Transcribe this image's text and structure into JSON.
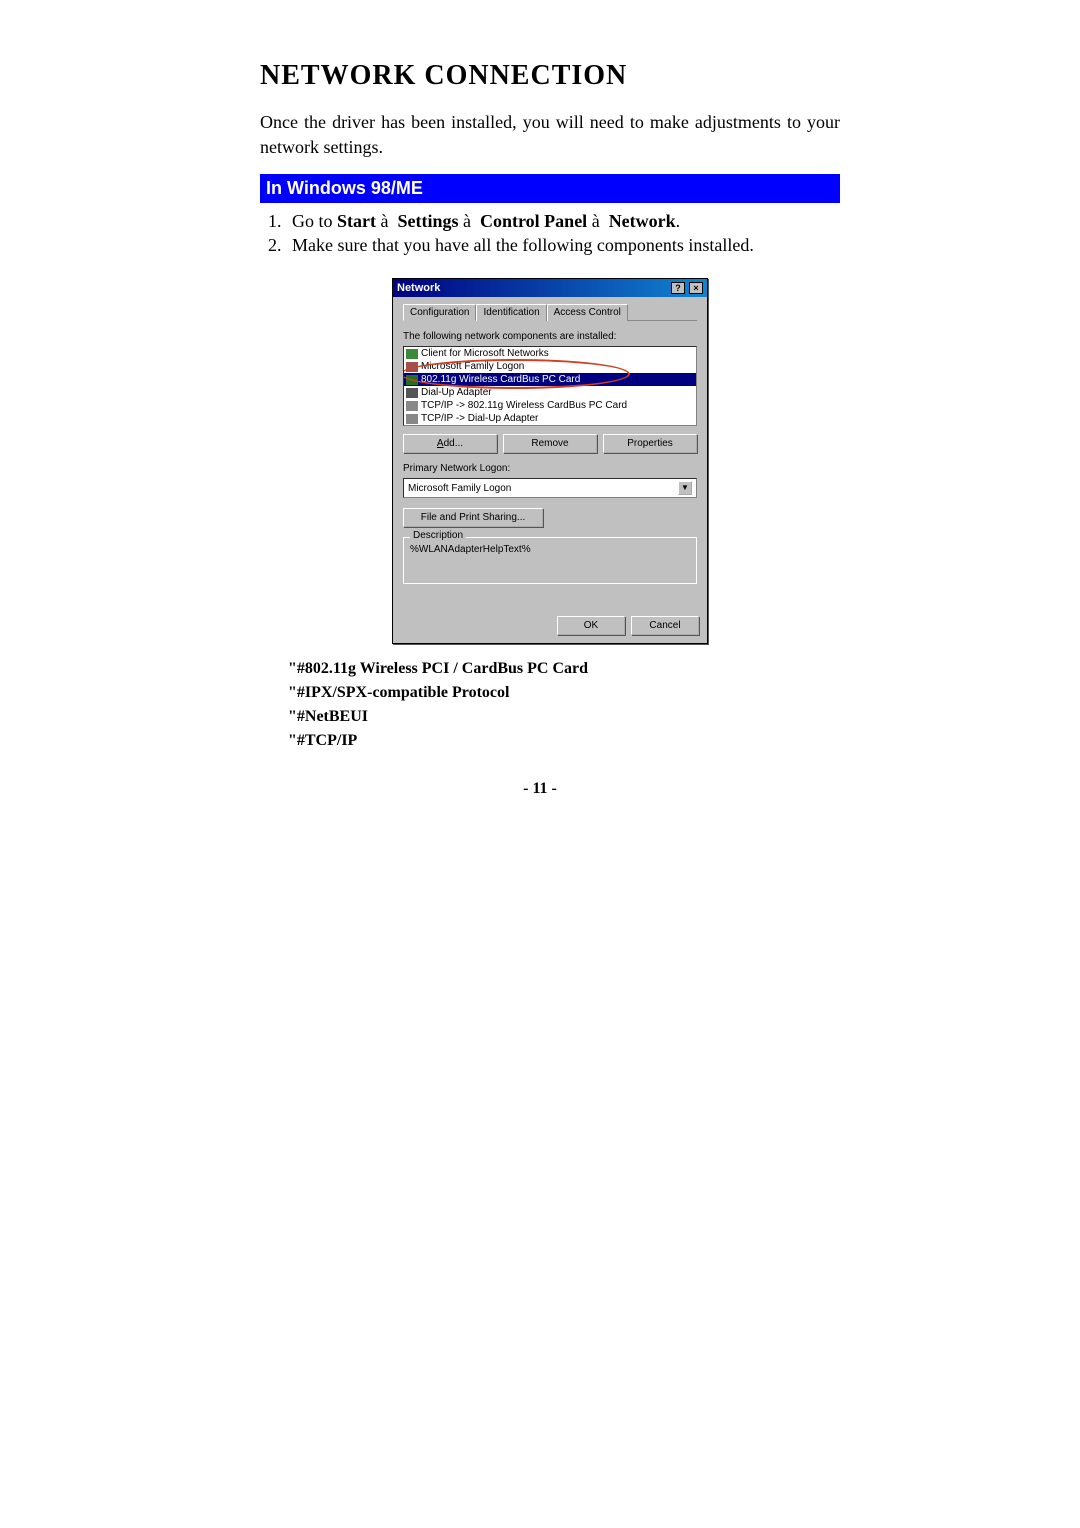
{
  "heading": "NETWORK CONNECTION",
  "intro": "Once the driver has been installed, you will need to make adjustments to your network settings.",
  "section_title": "In Windows 98/ME",
  "step1_prefix": "Go to ",
  "step1_parts": {
    "start": "Start",
    "settings": "Settings",
    "cp": "Control Panel",
    "network": "Network"
  },
  "step1_sep": "à",
  "step2": "Make sure that you have all the following components installed.",
  "dialog": {
    "title": "Network",
    "tabs": [
      "Configuration",
      "Identification",
      "Access Control"
    ],
    "list_label": "The following network components are installed:",
    "items": [
      "Client for Microsoft Networks",
      "Microsoft Family Logon",
      "802.11g Wireless CardBus PC Card",
      "Dial-Up Adapter",
      "TCP/IP -> 802.11g Wireless CardBus PC Card",
      "TCP/IP -> Dial-Up Adapter"
    ],
    "buttons": {
      "add": "Add...",
      "remove": "Remove",
      "properties": "Properties"
    },
    "logon_label": "Primary Network Logon:",
    "logon_value": "Microsoft Family Logon",
    "fps": "File and Print Sharing...",
    "desc_label": "Description",
    "desc_text": "%WLANAdapterHelpText%",
    "ok": "OK",
    "cancel": "Cancel"
  },
  "components": [
    "\"#802.11g Wireless PCI / CardBus PC Card",
    "\"#IPX/SPX-compatible Protocol",
    "\"#NetBEUI",
    "\"#TCP/IP"
  ],
  "page_number": "- 11 -"
}
